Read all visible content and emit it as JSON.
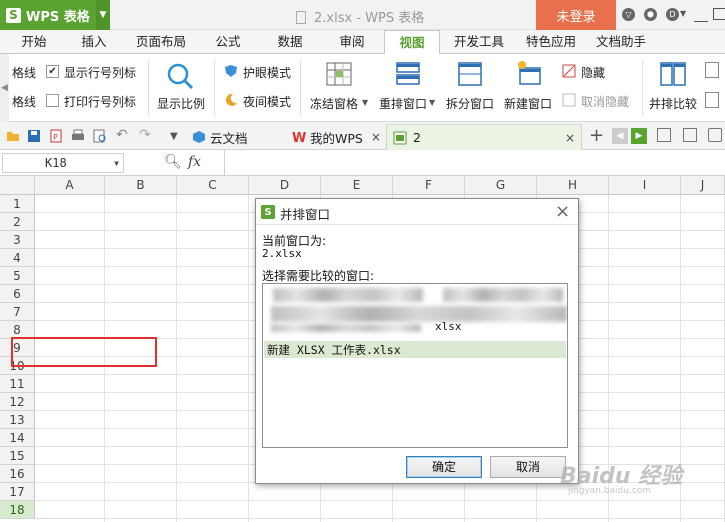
{
  "app": {
    "name": "WPS 表格",
    "logo_letter": "S",
    "window_title": "2.xlsx - WPS 表格",
    "login_label": "未登录"
  },
  "menu_tabs": [
    "开始",
    "插入",
    "页面布局",
    "公式",
    "数据",
    "审阅",
    "视图",
    "开发工具",
    "特色应用",
    "文档助手"
  ],
  "active_tab": "视图",
  "ribbon": {
    "gridlines": "格线",
    "show_row_col_headers": "显示行号列标",
    "print_gridlines": "格线",
    "print_row_col_headers": "打印行号列标",
    "zoom": "显示比例",
    "eye_protection": "护眼模式",
    "night_mode": "夜间模式",
    "freeze_panes": "冻结窗格",
    "rearrange_windows": "重排窗口",
    "split_window": "拆分窗口",
    "new_window": "新建窗口",
    "hide": "隐藏",
    "unhide": "取消隐藏",
    "side_by_side": "并排比较"
  },
  "doc_tabs": {
    "cloud": "云文档",
    "my_wps": "我的WPS",
    "current": "2"
  },
  "formula_bar": {
    "cell_ref": "K18",
    "fx": "fx"
  },
  "columns": [
    "A",
    "B",
    "C",
    "D",
    "E",
    "F",
    "G",
    "H",
    "I",
    "J"
  ],
  "rows": [
    "1",
    "2",
    "3",
    "4",
    "5",
    "6",
    "7",
    "8",
    "9",
    "10",
    "11",
    "12",
    "13",
    "14",
    "15",
    "16",
    "17",
    "18"
  ],
  "selected_row": "18",
  "dialog": {
    "title": "并排窗口",
    "current_window_label": "当前窗口为:",
    "current_window_value": "2.xlsx",
    "select_label": "选择需要比较的窗口:",
    "partial_item_suffix": "xlsx",
    "selected_item": "新建 XLSX 工作表.xlsx",
    "ok_label": "确定",
    "cancel_label": "取消"
  },
  "watermark": {
    "text": "Baidu 经验",
    "url": "jingyan.baidu.com"
  },
  "colors": {
    "brand_green": "#5aa332",
    "login_orange": "#e8704c",
    "selection_green": "#dbe9d2",
    "highlight_red": "#e03030"
  }
}
